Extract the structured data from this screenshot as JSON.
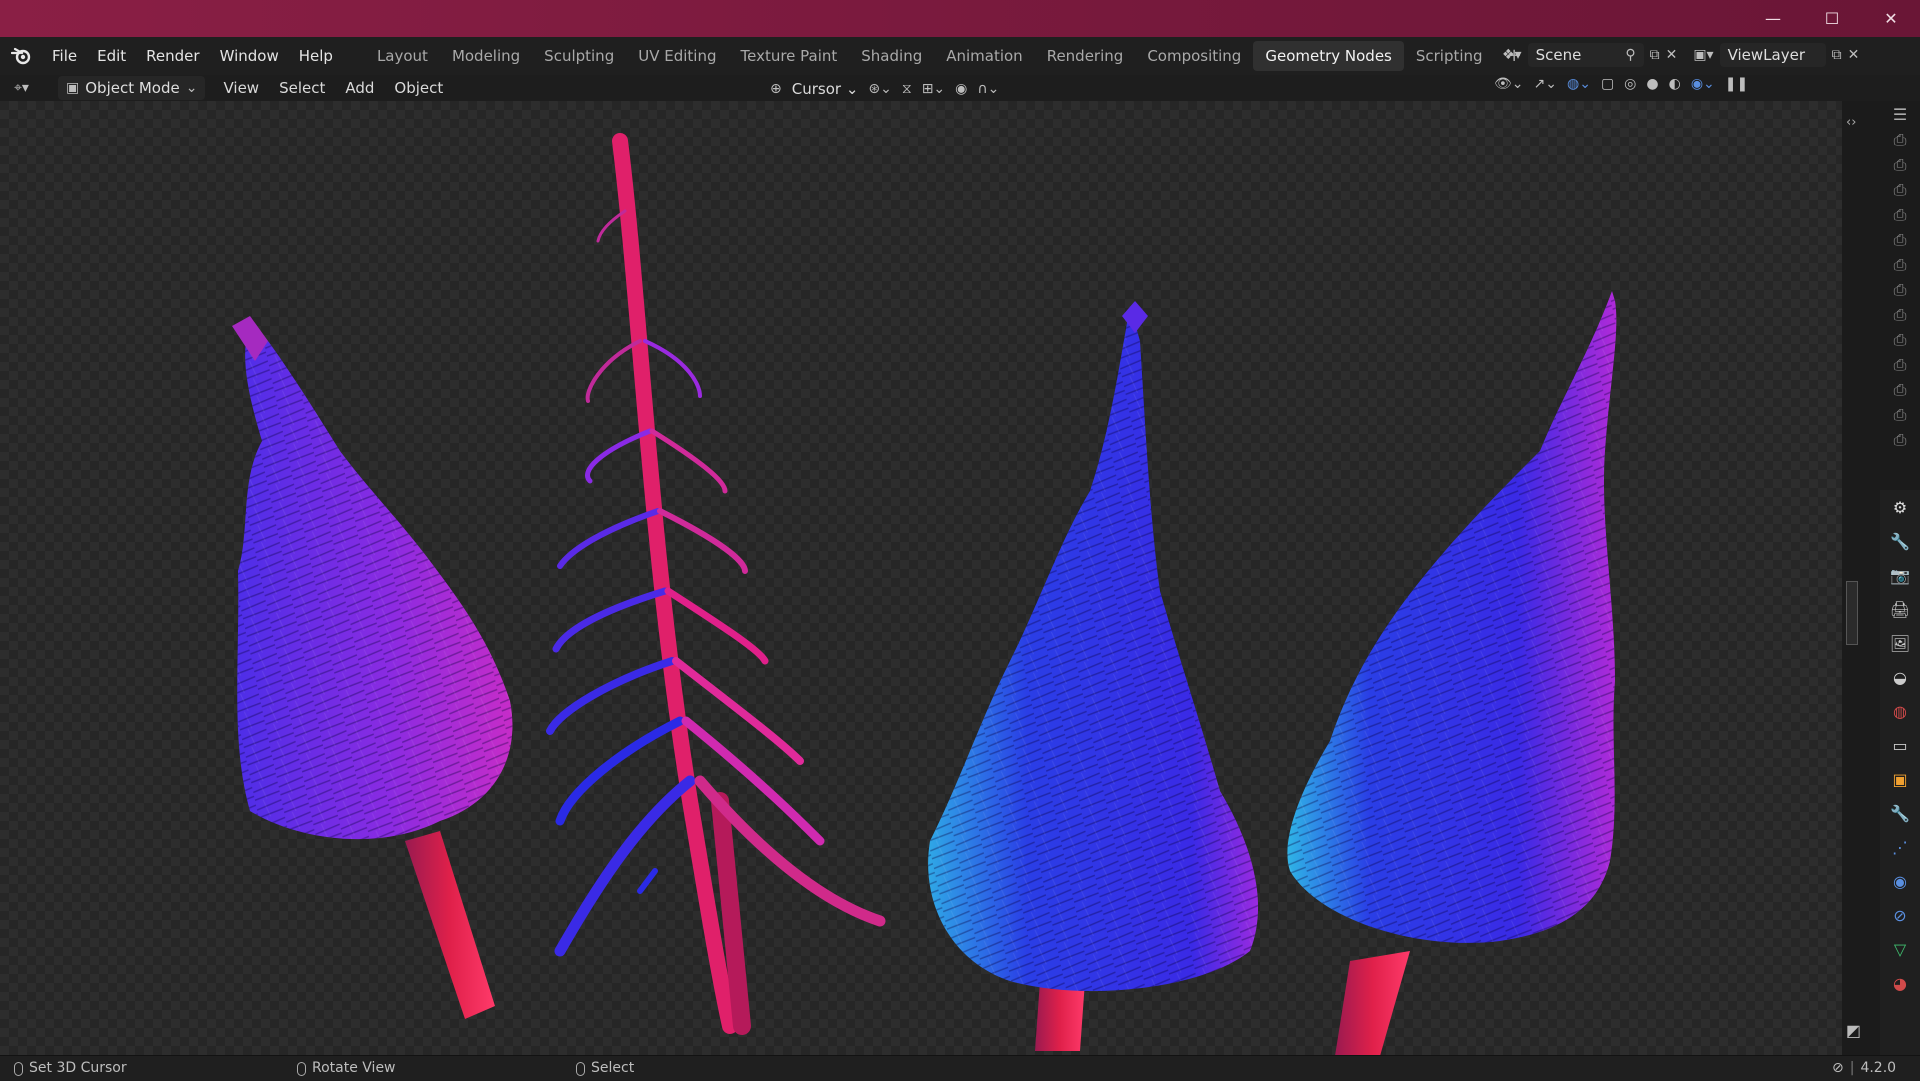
{
  "menu": [
    "File",
    "Edit",
    "Render",
    "Window",
    "Help"
  ],
  "workspaces": [
    "Layout",
    "Modeling",
    "Sculpting",
    "UV Editing",
    "Texture Paint",
    "Shading",
    "Animation",
    "Rendering",
    "Compositing",
    "Geometry Nodes",
    "Scripting"
  ],
  "active_workspace": "Geometry Nodes",
  "scene": "Scene",
  "view_layer": "ViewLayer",
  "header": {
    "mode": "Object Mode",
    "view": "View",
    "select": "Select",
    "add": "Add",
    "object": "Object",
    "pivot": "Cursor"
  },
  "status": {
    "left": "Set 3D Cursor",
    "middle": "Rotate View",
    "right": "Select",
    "version": "4.2.0"
  },
  "icons": {
    "blender": "blender-logo-icon",
    "minimize": "minimize-icon",
    "maximize": "maximize-icon",
    "close": "close-icon"
  },
  "colors": {
    "titlebar": "#7b1a3e",
    "tree_magenta": "#d62aa0",
    "tree_violet": "#8a2be2",
    "tree_blue": "#2a2ae0",
    "tree_cyan": "#2ab0e0",
    "trunk_red": "#e0204a"
  }
}
